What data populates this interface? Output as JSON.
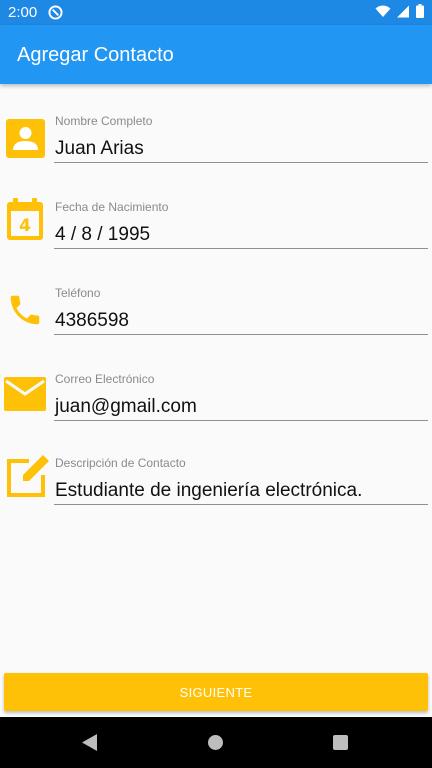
{
  "status_bar": {
    "time": "2:00",
    "icons": [
      "app-notification-icon",
      "wifi-icon",
      "signal-icon",
      "battery-icon"
    ]
  },
  "app_bar": {
    "title": "Agregar Contacto"
  },
  "form": {
    "accent_color": "#ffc107",
    "fields": [
      {
        "icon": "person-icon",
        "label": "Nombre Completo",
        "value": "Juan Arias"
      },
      {
        "icon": "calendar-icon",
        "label": "Fecha de Nacimiento",
        "value": "4 / 8 / 1995"
      },
      {
        "icon": "phone-icon",
        "label": "Teléfono",
        "value": "4386598"
      },
      {
        "icon": "email-icon",
        "label": "Correo Electrónico",
        "value": "juan@gmail.com"
      },
      {
        "icon": "edit-icon",
        "label": "Descripción de Contacto",
        "value": "Estudiante de ingeniería electrónica."
      }
    ]
  },
  "actions": {
    "next_label": "SIGUIENTE"
  },
  "colors": {
    "status_bar": "#1e88e5",
    "app_bar": "#2196f3",
    "accent": "#ffc107"
  }
}
